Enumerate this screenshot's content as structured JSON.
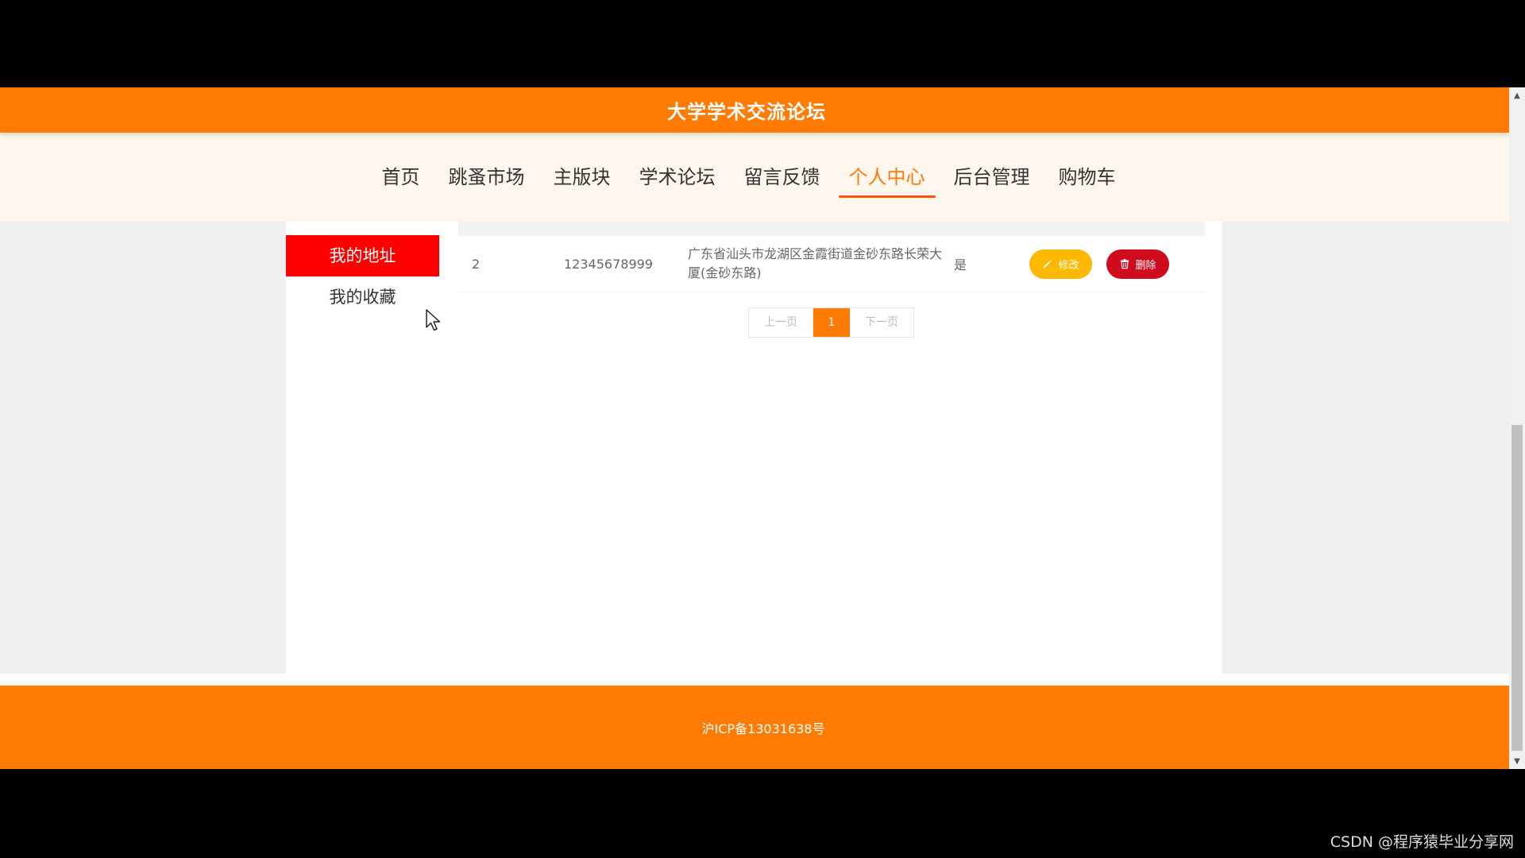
{
  "header": {
    "site_title": "大学学术交流论坛"
  },
  "nav": {
    "items": [
      {
        "label": "首页"
      },
      {
        "label": "跳蚤市场"
      },
      {
        "label": "主版块"
      },
      {
        "label": "学术论坛"
      },
      {
        "label": "留言反馈"
      },
      {
        "label": "个人中心",
        "active": true
      },
      {
        "label": "后台管理"
      },
      {
        "label": "购物车"
      }
    ]
  },
  "sidebar": {
    "items": [
      {
        "label": "我的地址",
        "active": true
      },
      {
        "label": "我的收藏"
      }
    ]
  },
  "address_table": {
    "rows": [
      {
        "id": "2",
        "phone": "12345678999",
        "address": "广东省汕头市龙湖区金霞街道金砂东路长荣大厦(金砂东路)",
        "is_default": "是",
        "edit_label": "修改",
        "delete_label": "删除"
      }
    ]
  },
  "pagination": {
    "prev_label": "上一页",
    "current_page": "1",
    "next_label": "下一页"
  },
  "footer": {
    "icp": "沪ICP备13031638号"
  },
  "watermark": "CSDN @程序猿毕业分享网",
  "colors": {
    "brand_orange": "#ff7b04",
    "nav_bg": "#fff7ee",
    "sidebar_active": "#ff0000",
    "edit_button": "#ffb800",
    "delete_button": "#d10b1e"
  }
}
